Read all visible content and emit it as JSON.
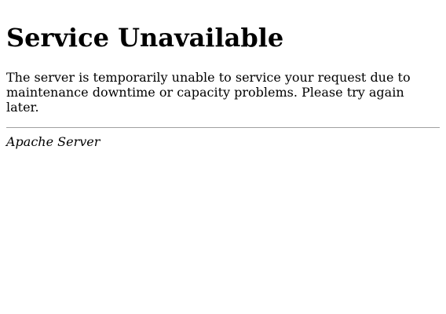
{
  "error": {
    "title": "Service Unavailable",
    "message": "The server is temporarily unable to service your request due to maintenance downtime or capacity problems. Please try again later.",
    "server_signature": "Apache Server"
  }
}
